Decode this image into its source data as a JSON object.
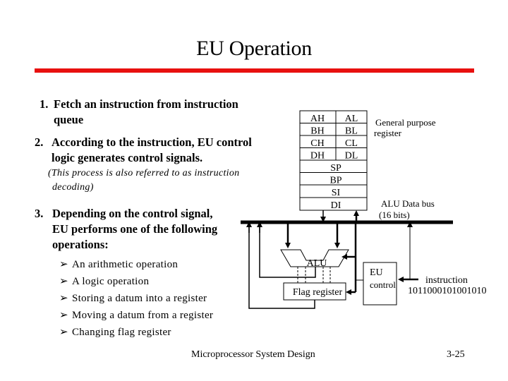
{
  "slide": {
    "title": "EU Operation",
    "accent_color": "#e8100f",
    "points": [
      {
        "number": "1.",
        "line1": "Fetch an instruction from instruction",
        "line2": "queue"
      },
      {
        "number": "2.",
        "line1": "According to the instruction, EU control",
        "line2": "logic generates control signals."
      },
      {
        "number": "3.",
        "line1": "Depending on the control signal,",
        "line2": "EU performs one of the following",
        "line3": "operations:"
      }
    ],
    "note": {
      "line1": "(This process is also referred to as instruction",
      "line2": "decoding)"
    },
    "operations": [
      "An arithmetic operation",
      "A logic operation",
      "Storing a datum into a register",
      "Moving a datum from a register",
      "Changing flag register"
    ],
    "bullet_icon": "arrowhead-bullet",
    "footer": {
      "course": "Microprocessor System Design",
      "page": "3-25"
    }
  },
  "diagram": {
    "registers": {
      "pairs": [
        [
          "AH",
          "AL"
        ],
        [
          "BH",
          "BL"
        ],
        [
          "CH",
          "CL"
        ],
        [
          "DH",
          "DL"
        ]
      ],
      "singles": [
        "SP",
        "BP",
        "SI",
        "DI"
      ],
      "label_line1": "General purpose",
      "label_line2": "register"
    },
    "bus": {
      "label_line1": "ALU Data bus",
      "label_line2": "(16 bits)"
    },
    "alu_label": "ALU",
    "flag_register_label": "Flag register",
    "eu_control": {
      "line1": "EU",
      "line2": "control"
    },
    "instruction": {
      "label": "instruction",
      "bits": "1011000101001010"
    }
  }
}
